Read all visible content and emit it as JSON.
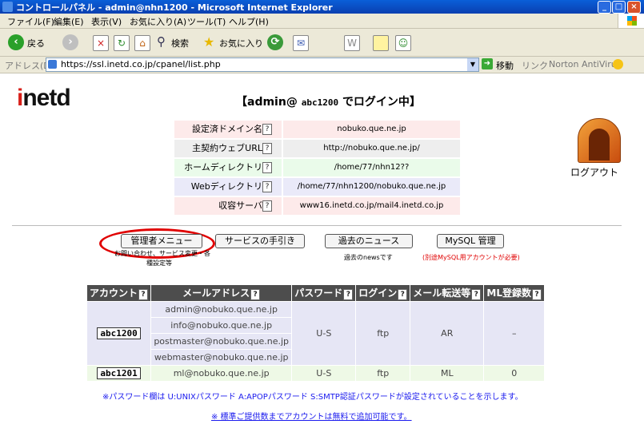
{
  "window": {
    "title": "コントロールパネル - admin@nhn1200 - Microsoft Internet Explorer"
  },
  "menu": [
    "ファイル(F)",
    "編集(E)",
    "表示(V)",
    "お気に入り(A)",
    "ツール(T)",
    "ヘルプ(H)"
  ],
  "toolbar": {
    "back": "戻る",
    "search": "検索",
    "favorites": "お気に入り"
  },
  "address": {
    "label": "アドレス(D)",
    "url": "https://ssl.inetd.co.jp/cpanel/list.php",
    "go": "移動",
    "links": "リンク",
    "norton": "Norton AntiVirus"
  },
  "page": {
    "logo": "inetd",
    "login_user": "admin@",
    "login_account": "abc1200",
    "login_suffix": "でログイン中",
    "info": [
      {
        "label": "設定済ドメイン名",
        "value": "nobuko.que.ne.jp"
      },
      {
        "label": "主契約ウェブURL",
        "value": "http://nobuko.que.ne.jp/"
      },
      {
        "label": "ホームディレクトリ",
        "value": "/home/77/nhn12??"
      },
      {
        "label": "Webディレクトリ",
        "value": "/home/77/nhn1200/nobuko.que.ne.jp"
      },
      {
        "label": "収容サーバ",
        "value": "www16.inetd.co.jp/mail4.inetd.co.jp"
      }
    ],
    "info_colors": [
      "#fdeaea",
      "#eeeeee",
      "#eafbea",
      "#eaeaf9",
      "#fdeaea"
    ],
    "logout": "ログアウト",
    "buttons": {
      "admin": "管理者メニュー",
      "admin_note1": "お問い合わせ、サービス変更・各",
      "admin_note2": "種設定等",
      "service": "サービスの手引き",
      "news": "過去のニュース",
      "news_note": "過去のnewsです",
      "mysql": "MySQL 管理",
      "mysql_note": "(別途MySQL用アカウントが必要)"
    },
    "table": {
      "headers": [
        "アカウント",
        "メールアドレス",
        "パスワード",
        "ログイン",
        "メール転送等",
        "ML登録数"
      ],
      "accounts": [
        {
          "id": "abc1200",
          "emails": [
            "admin@nobuko.que.ne.jp",
            "info@nobuko.que.ne.jp",
            "postmaster@nobuko.que.ne.jp",
            "webmaster@nobuko.que.ne.jp"
          ],
          "password": "U-S",
          "login": "ftp",
          "forward": "AR",
          "ml": "–"
        },
        {
          "id": "abc1201",
          "emails": [
            "ml@nobuko.que.ne.jp"
          ],
          "password": "U-S",
          "login": "ftp",
          "forward": "ML",
          "ml": "0"
        }
      ]
    },
    "footnote": "※パスワード欄は U:UNIXパスワード A:APOPパスワード S:SMTP認証パスワードが設定されていることを示します。",
    "footlink": "※ 標準ご提供数までアカウントは無料で追加可能です。"
  }
}
